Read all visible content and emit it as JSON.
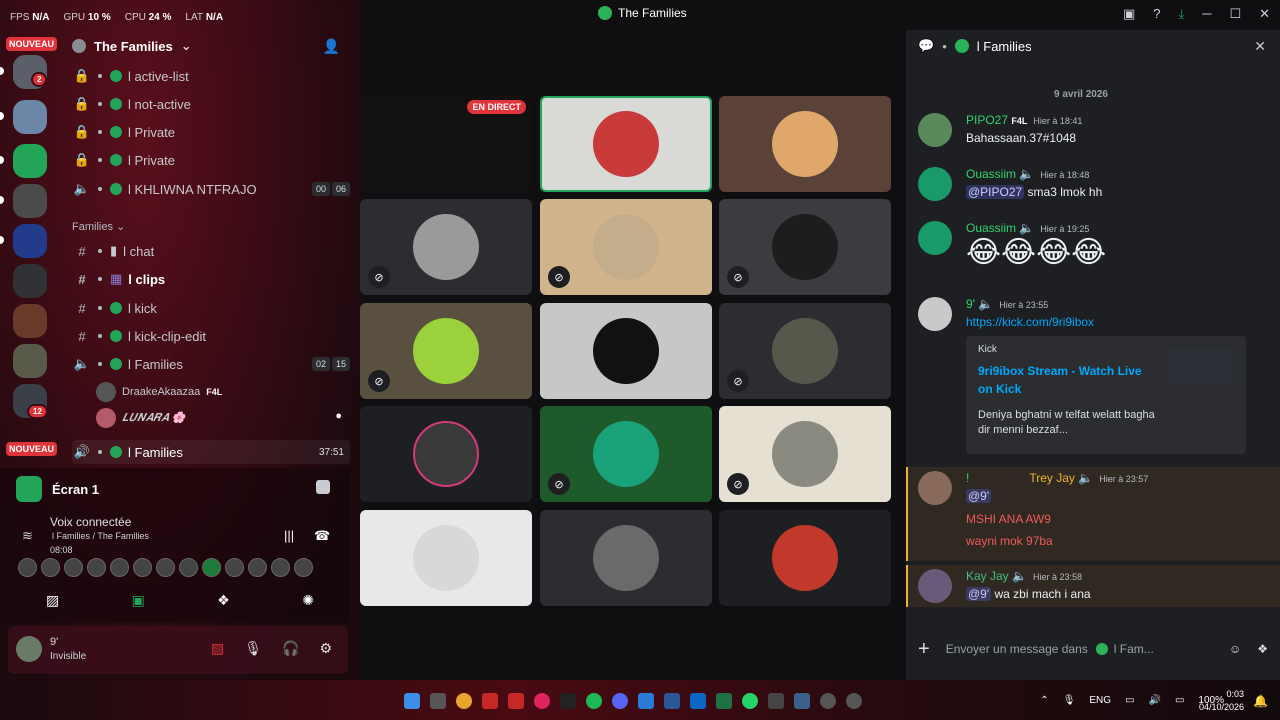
{
  "perf": {
    "fps_label": "FPS",
    "fps": "N/A",
    "gpu_label": "GPU",
    "gpu": "10 %",
    "cpu_label": "CPU",
    "cpu": "24 %",
    "lat_label": "LAT",
    "lat": "N/A"
  },
  "window": {
    "title": "The Families"
  },
  "rail": {
    "badge_top": "NOUVEAU",
    "badge_bottom": "NOUVEAU",
    "count_2": "2",
    "count_12": "12"
  },
  "server": {
    "name": "The Families"
  },
  "channels": [
    {
      "icon": "lock",
      "label": "l active-list"
    },
    {
      "icon": "lock",
      "label": "l not-active"
    },
    {
      "icon": "lock",
      "label": "l Private"
    },
    {
      "icon": "lock",
      "label": "l Private"
    },
    {
      "icon": "speaker",
      "label": "l KHLIWNA NTFRAJO",
      "tag1": "00",
      "tag2": "06"
    }
  ],
  "category": {
    "label": "Families"
  },
  "families_channels": [
    {
      "icon": "#",
      "label": "l chat"
    },
    {
      "icon": "#",
      "label": "l clips"
    },
    {
      "icon": "#",
      "label": "l kick"
    },
    {
      "icon": "#",
      "label": "l kick-clip-edit"
    },
    {
      "icon": "speaker",
      "label": "l Families",
      "tag1": "02",
      "tag2": "15"
    }
  ],
  "members": [
    {
      "name": "DraakeAkaazaa",
      "tag": "F4L"
    },
    {
      "name": "𝑳𝑼𝑵𝑨𝑹𝑨 🌸"
    }
  ],
  "active_voice": {
    "label": "l Families",
    "time": "37:51"
  },
  "screen": {
    "label": "Écran 1"
  },
  "voice": {
    "connected": "Voix connectée",
    "channel": "l Families / The Families",
    "time": "08:08"
  },
  "user": {
    "name": "9'",
    "status": "Invisible"
  },
  "grid": {
    "live_label": "EN DIRECT"
  },
  "chat": {
    "header": "l Families",
    "date": "9 avril 2026",
    "messages": [
      {
        "name": "PIPO27",
        "tag": "F4L",
        "time": "Hier à 18:41",
        "text": "Bahassaan.37#1048"
      },
      {
        "name": "Ouassiim",
        "time": "Hier à 18:48",
        "mention": "@PIPO27",
        "text": " sma3 lmok hh"
      },
      {
        "name": "Ouassiim",
        "time": "Hier à 19:25",
        "text": "😂😂😂😂"
      },
      {
        "name": "9'",
        "time": "Hier à 23:55",
        "text": "https://kick.com/9ri9ibox"
      },
      {
        "name": "Trey Jay",
        "prefix": "!",
        "time": "Hier à 23:57",
        "mention": "@9'",
        "line2": "MSHI ANA AW9",
        "line3": "wayni mok 97ba"
      },
      {
        "name": "Kay Jay",
        "time": "Hier à 23:58",
        "mention": "@9'",
        "text": " wa zbi mach i ana"
      }
    ],
    "embed": {
      "source": "Kick",
      "title": "9ri9ibox Stream - Watch Live on Kick",
      "desc": "Deniya bghatni w telfat welatt bagha dir menni bezzaf..."
    },
    "composer_placeholder": "Envoyer un message dans",
    "composer_channel": "l Fam..."
  },
  "taskbar": {
    "lang": "ENG",
    "battery": "100%",
    "time": "0:03",
    "date": "04/10/2026"
  },
  "colors": {
    "accent_green": "#23a559",
    "danger": "#e0333a",
    "link": "#00a8fc"
  }
}
